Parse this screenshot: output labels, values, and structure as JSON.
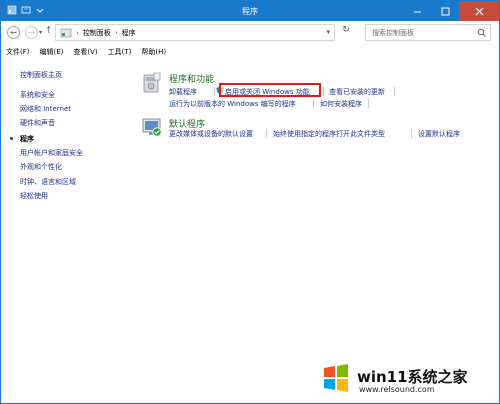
{
  "window": {
    "title": "程序"
  },
  "address": {
    "segments": [
      "控制面板",
      "程序"
    ]
  },
  "search": {
    "placeholder": "搜索控制面板"
  },
  "menu": [
    "文件(F)",
    "编辑(E)",
    "查看(V)",
    "工具(T)",
    "帮助(H)"
  ],
  "sidebar": {
    "items": [
      {
        "label": "控制面板主页"
      },
      {
        "label": "系统和安全"
      },
      {
        "label": "网络和 Internet"
      },
      {
        "label": "硬件和声音"
      },
      {
        "label": "程序"
      },
      {
        "label": "用户帐户和家庭安全"
      },
      {
        "label": "外观和个性化"
      },
      {
        "label": "时钟、语言和区域"
      },
      {
        "label": "轻松使用"
      }
    ]
  },
  "programs": {
    "title": "程序和功能",
    "links": [
      "卸载程序",
      "启用或关闭 Windows 功能",
      "查看已安装的更新",
      "运行为以前版本的 Windows 编写的程序",
      "如何安装程序"
    ]
  },
  "defaults": {
    "title": "默认程序",
    "links": [
      "更改媒体或设备的默认设置",
      "始终使用指定的程序打开此文件类型",
      "设置默认程序"
    ]
  },
  "watermark": {
    "title": "win11系统之家",
    "url": "www.relsound.com"
  },
  "colors": {
    "titlebar": "#1979ca",
    "link": "#1e3287",
    "section_title": "#1e6e1e",
    "highlight": "#e01a1a"
  }
}
